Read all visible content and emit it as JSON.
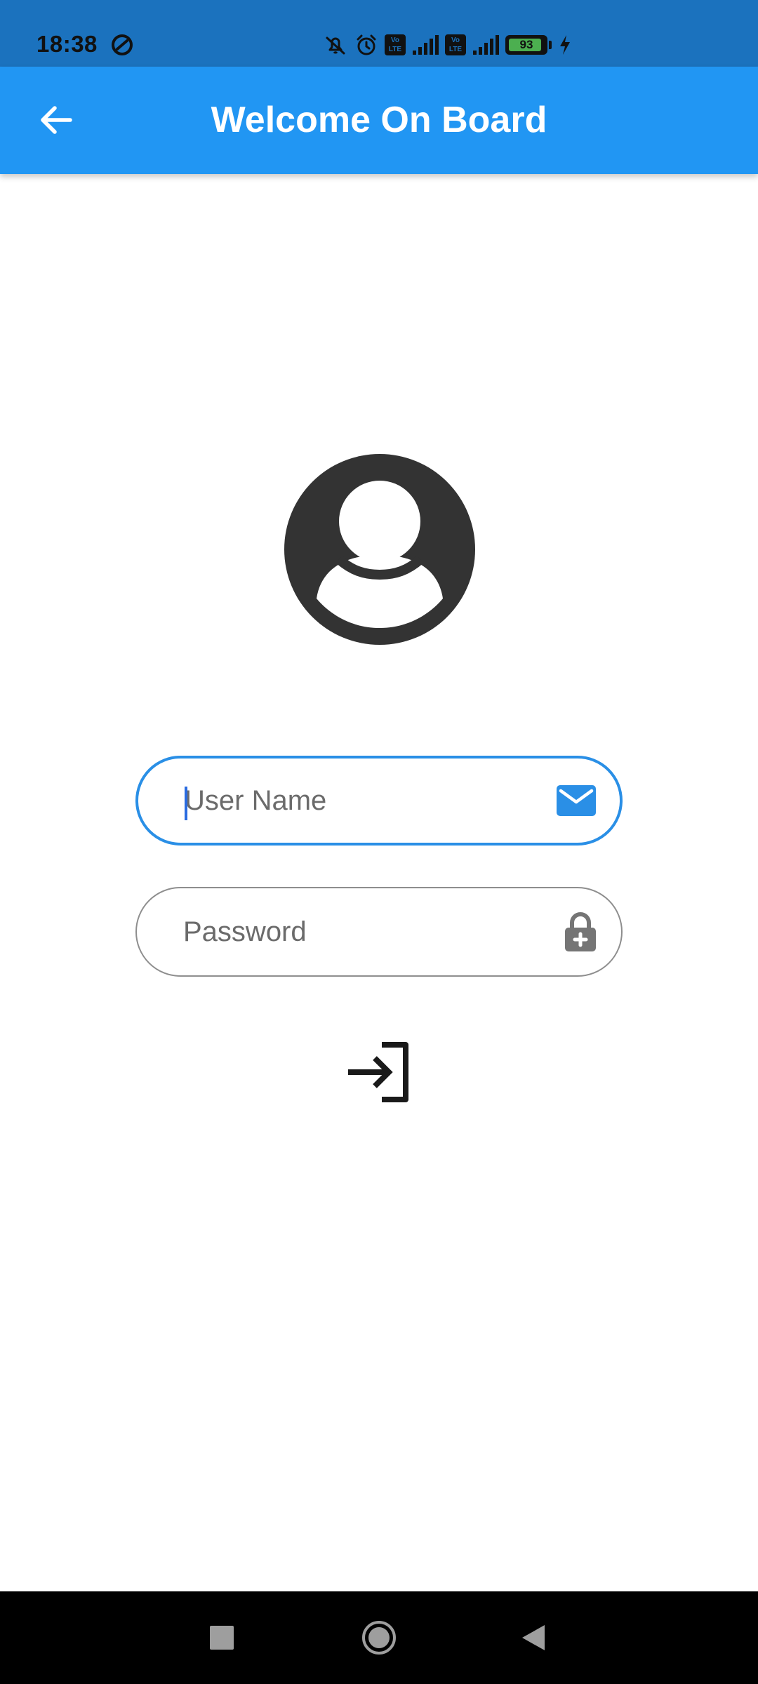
{
  "status_bar": {
    "time": "18:38",
    "volte_label": "Vo LTE",
    "battery_level": "93",
    "battery_fraction": 0.93,
    "icons": [
      "data-saver-icon",
      "bell-off-icon",
      "alarm-icon",
      "volte-icon",
      "signal-icon",
      "volte-icon",
      "signal-icon",
      "battery-icon",
      "charging-icon"
    ]
  },
  "app_bar": {
    "title": "Welcome On Board",
    "back_icon": "arrow-back-icon",
    "background": "#2196f3"
  },
  "avatar": {
    "icon": "account-circle-icon",
    "color": "#333333"
  },
  "form": {
    "username": {
      "placeholder": "User Name",
      "value": "",
      "icon": "mail-icon",
      "focused": true,
      "border_color": "#2a8fe6"
    },
    "password": {
      "placeholder": "Password",
      "value": "",
      "icon": "lock-icon",
      "border_color": "#8e8e8e"
    },
    "login_icon": "login-icon"
  },
  "nav_bar": {
    "items": [
      "recents-icon",
      "home-icon",
      "back-icon"
    ]
  },
  "colors": {
    "status_bar": "#1b72be",
    "accent": "#2196f3",
    "icon_mail": "#2a8fe6",
    "icon_lock": "#757575"
  }
}
